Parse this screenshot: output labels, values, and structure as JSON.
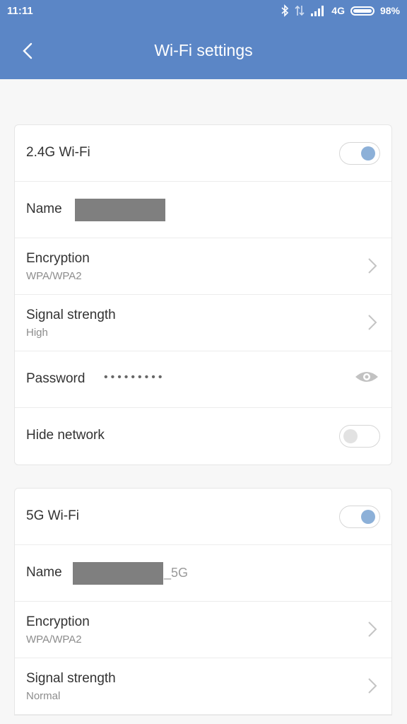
{
  "status": {
    "time": "11:11",
    "network": "4G",
    "battery": "98%",
    "battery_level": 0.98
  },
  "header": {
    "title": "Wi-Fi settings",
    "back_icon": "chevron-left-icon"
  },
  "wifi24": {
    "title": "2.4G Wi-Fi",
    "enabled": true,
    "name_label": "Name",
    "encryption_label": "Encryption",
    "encryption_value": "WPA/WPA2",
    "signal_label": "Signal strength",
    "signal_value": "High",
    "password_label": "Password",
    "password_mask": "•••••••••",
    "hide_label": "Hide network",
    "hide_enabled": false
  },
  "wifi5": {
    "title": "5G Wi-Fi",
    "enabled": true,
    "name_label": "Name",
    "name_suffix": "_5G",
    "encryption_label": "Encryption",
    "encryption_value": "WPA/WPA2",
    "signal_label": "Signal strength",
    "signal_value": "Normal"
  },
  "colors": {
    "header": "#5b86c6",
    "toggle_on_knob": "#8cb0d8",
    "toggle_off_knob": "#e2e2e2",
    "redacted": "#7f7f7f"
  }
}
